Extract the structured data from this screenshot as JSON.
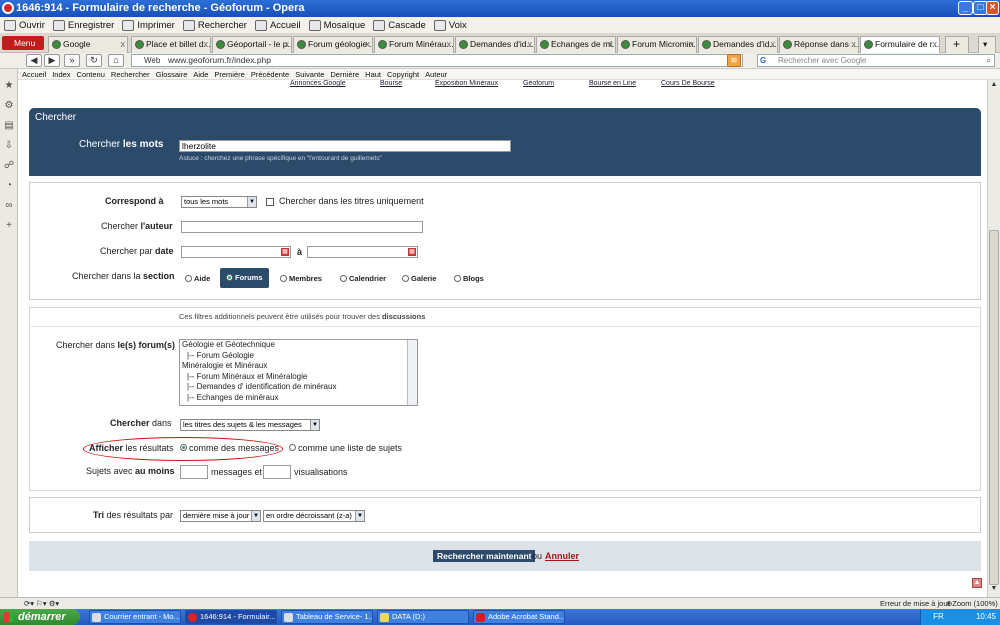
{
  "window": {
    "title": "1646:914 - Formulaire de recherche - Géoforum - Opera"
  },
  "toolbar": {
    "items": [
      "Ouvrir",
      "Enregistrer",
      "Imprimer",
      "Rechercher",
      "Accueil",
      "Mosaïque",
      "Cascade",
      "Voix"
    ]
  },
  "browser": {
    "menu_label": "Menu",
    "url": "www.geoforum.fr/index.php",
    "web_label": "Web",
    "search_placeholder": "Rechercher avec Google"
  },
  "tabs": [
    "Google",
    "Place et billet d...",
    "Géoportail - le p...",
    "Forum géologie ...",
    "Forum Minérau...",
    "Demandes d'id...",
    "Echanges de mi...",
    "Forum Micromin...",
    "Demandes d'id...",
    "Réponse dans ...",
    "Formulaire de r..."
  ],
  "bookmarks": [
    "Accueil",
    "Index",
    "Contenu",
    "Rechercher",
    "Glossaire",
    "Aide",
    "Première",
    "Précédente",
    "Suivante",
    "Dernière",
    "Haut",
    "Copyright",
    "Auteur"
  ],
  "toplinks": [
    "Annonces Google",
    "Bourse",
    "Exposition Minéraux",
    "Géoforum",
    "Bourse en Line",
    "Cours De Bourse"
  ],
  "search": {
    "header": "Chercher",
    "words_label_pre": "Chercher ",
    "words_label_bold": "les mots",
    "words_value": "lherzolite",
    "tip": "Astuce : cherchez une phrase spécifique en \"l'entourant de guillemets\"",
    "match_label": "Correspond à",
    "match_value": "tous les mots",
    "titles_only_label": "Chercher dans les titres uniquement",
    "author_label_pre": "Chercher ",
    "author_label_bold": "l'auteur",
    "date_label_pre": "Chercher par ",
    "date_label_bold": "date",
    "date_sep": "à",
    "section_label_pre": "Chercher dans la ",
    "section_label_bold": "section",
    "sections": [
      "Aide",
      "Forums",
      "Membres",
      "Calendrier",
      "Galerie",
      "Blogs"
    ],
    "filters_note_pre": "Ces filtres additionnels peuvent être utilisés pour trouver des ",
    "filters_note_bold": "discussions",
    "forums_label_pre": "Chercher dans ",
    "forums_label_bold": "le(s) forum(s)",
    "forums": [
      "Géologie et Géotechnique",
      "|-- Forum Géologie",
      "Minéralogie et Minéraux",
      "|-- Forum Minéraux et Minéralogie",
      "|-- Demandes d' identification de minéraux",
      "|-- Echanges de minéraux"
    ],
    "in_label_bold": "Chercher",
    "in_label_post": " dans",
    "in_value": "les titres des sujets & les messages",
    "show_label_bold": "Afficher",
    "show_label_post": " les résultats",
    "show_options": [
      "comme des messages",
      "comme une liste de sujets"
    ],
    "min_label_pre": "Sujets avec ",
    "min_label_bold": "au moins",
    "messages_label": "messages et",
    "views_label": "visualisations",
    "sort_label_bold": "Tri",
    "sort_label_post": " des résultats par",
    "sort_value": "dernière mise à jour",
    "order_value": "en ordre décroissant (z-a)",
    "submit": "Rechercher maintenant",
    "or": "ou",
    "cancel": "Annuler"
  },
  "status": {
    "left": "Erreur de mise à jour",
    "zoom": "Zoom (100%)"
  },
  "taskbar": {
    "start": "démarrer",
    "tasks": [
      "Courrier entrant - Mo...",
      "1646:914 - Formulair...",
      "Tableau de Service- 1...",
      "DATA (D:)",
      "Adobe Acrobat Stand..."
    ],
    "lang": "FR",
    "time": "10:45"
  }
}
